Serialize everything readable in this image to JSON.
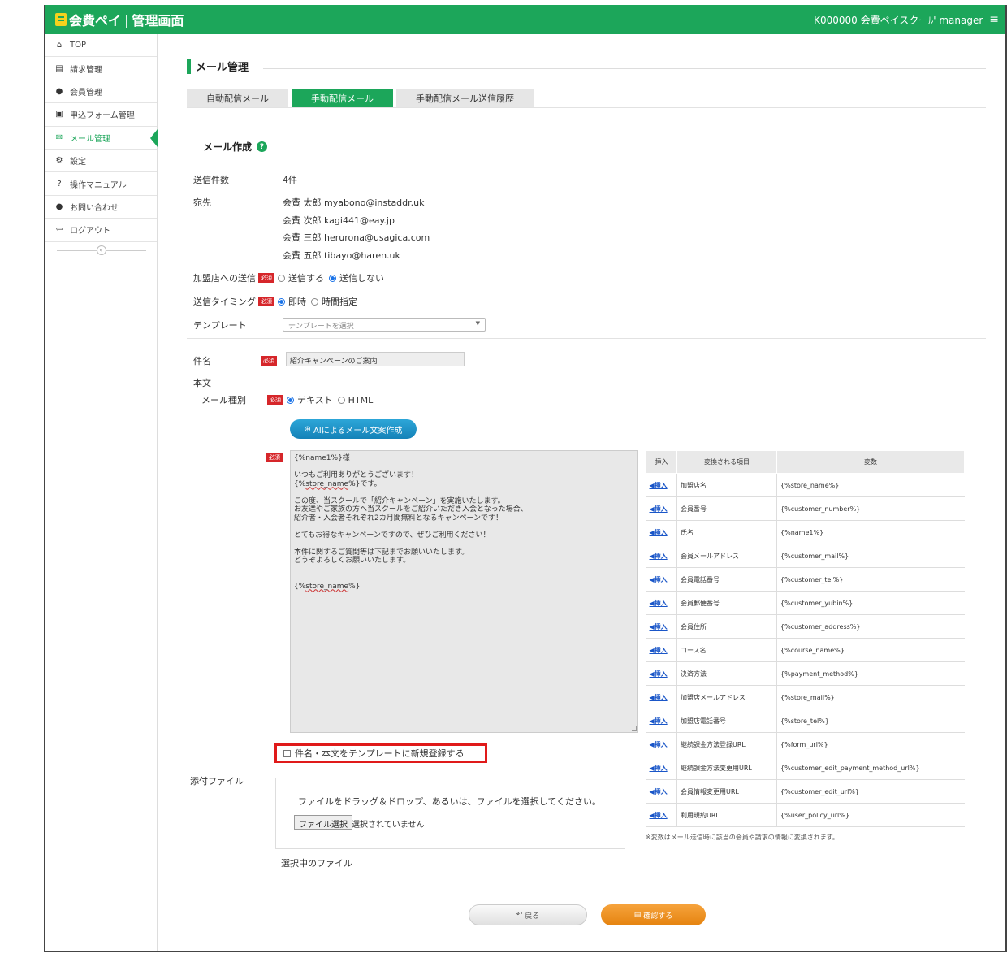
{
  "header": {
    "brand_left": "会費ペイ",
    "brand_sep": "|",
    "brand_right": "管理画面",
    "account": "K000000 会費ペイスクーﾙ' manager",
    "menu_icon": "hamburger-icon"
  },
  "sidebar": {
    "items": [
      {
        "label": "TOP",
        "icon": "home-icon"
      },
      {
        "label": "請求管理",
        "icon": "book-icon"
      },
      {
        "label": "会員管理",
        "icon": "user-icon"
      },
      {
        "label": "申込フォーム管理",
        "icon": "form-icon"
      },
      {
        "label": "メール管理",
        "icon": "envelope-icon"
      },
      {
        "label": "設定",
        "icon": "gears-icon"
      },
      {
        "label": "操作マニュアル",
        "icon": "question-icon"
      },
      {
        "label": "お問い合わせ",
        "icon": "chat-icon"
      },
      {
        "label": "ログアウト",
        "icon": "logout-icon"
      }
    ],
    "collapse": "«"
  },
  "page": {
    "title": "メール管理",
    "tabs": [
      "自動配信メール",
      "手動配信メール",
      "手動配信メール送信履歴"
    ],
    "section": "メール作成",
    "help": "?"
  },
  "form": {
    "count_label": "送信件数",
    "count_value": "4件",
    "to_label": "宛先",
    "recipients": [
      "会費 太郎 myabono@instaddr.uk",
      "会費 次郎 kagi441@eay.jp",
      "会費 三郎 herurona@usagica.com",
      "会費 五郎 tibayo@haren.uk"
    ],
    "required": "必須",
    "store_send_label": "加盟店への送信",
    "store_send_opt1": "送信する",
    "store_send_opt2": "送信しない",
    "timing_label": "送信タイミング",
    "timing_opt1": "即時",
    "timing_opt2": "時間指定",
    "template_label": "テンプレート",
    "template_placeholder": "テンプレートを選択",
    "subject_label": "件名",
    "subject_value": "紹介キャンペーンのご案内",
    "body_label": "本文",
    "mailtype_label": "メール種別",
    "mailtype_opt1": "テキスト",
    "mailtype_opt2": "HTML",
    "ai_button": "AIによるメール文案作成",
    "body_lines": {
      "l1": "{%name1%}様",
      "l2": "いつもご利用ありがとうございます！",
      "l3a": "{%",
      "l3b": "store_name",
      "l3c": "%}です。",
      "l4": "この度、当スクールで「紹介キャンペーン」を実施いたします。",
      "l5": "お友達やご家族の方へ当スクールをご紹介いただき入会となった場合、",
      "l6": "紹介者・入会者それぞれ2カ月間無料となるキャンペーンです！",
      "l7": "とてもお得なキャンペーンですので、ぜひご利用ください！",
      "l8": "本件に関するご質問等は下記までお願いいたします。",
      "l9": "どうぞよろしくお願いいたします。",
      "l10a": "{%",
      "l10b": "store_name",
      "l10c": "%}"
    },
    "template_register": "件名・本文をテンプレートに新規登録する",
    "attach_label": "添付ファイル",
    "attach_msg": "ファイルをドラッグ＆ドロップ、あるいは、ファイルを選択してください。",
    "file_button": "ファイル選択",
    "file_none": "選択されていません",
    "selected_files": "選択中のファイル"
  },
  "vars": {
    "headers": [
      "挿入",
      "変換される項目",
      "変数"
    ],
    "insert": "◀挿入",
    "rows": [
      [
        "加盟店名",
        "{%store_name%}"
      ],
      [
        "会員番号",
        "{%customer_number%}"
      ],
      [
        "氏名",
        "{%name1%}"
      ],
      [
        "会員メールアドレス",
        "{%customer_mail%}"
      ],
      [
        "会員電話番号",
        "{%customer_tel%}"
      ],
      [
        "会員郵便番号",
        "{%customer_yubin%}"
      ],
      [
        "会員住所",
        "{%customer_address%}"
      ],
      [
        "コース名",
        "{%course_name%}"
      ],
      [
        "決済方法",
        "{%payment_method%}"
      ],
      [
        "加盟店メールアドレス",
        "{%store_mail%}"
      ],
      [
        "加盟店電話番号",
        "{%store_tel%}"
      ],
      [
        "継続課金方法登録URL",
        "{%form_url%}"
      ],
      [
        "継続課金方法変更用URL",
        "{%customer_edit_payment_method_url%}"
      ],
      [
        "会員情報変更用URL",
        "{%customer_edit_url%}"
      ],
      [
        "利用規約URL",
        "{%user_policy_url%}"
      ]
    ],
    "note": "※変数はメール送信時に該当の会員や請求の情報に変換されます。"
  },
  "actions": {
    "back": "戻る",
    "confirm": "確認する"
  }
}
